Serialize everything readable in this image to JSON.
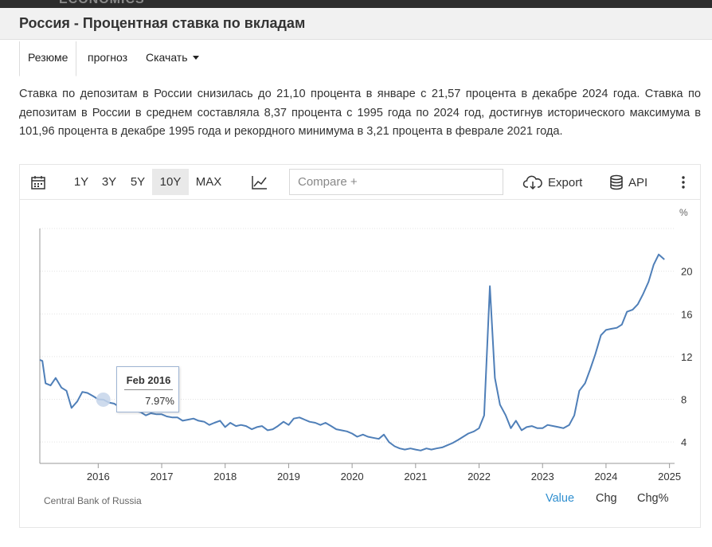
{
  "header": {
    "brand": "ECONOMICS",
    "title": "Россия - Процентная ставка по вкладам"
  },
  "tabs": [
    {
      "label": "Резюме"
    },
    {
      "label": "прогноз"
    },
    {
      "label": "Скачать"
    }
  ],
  "description": "Ставка по депозитам в России снизилась до 21,10 процента в январе с 21,57 процента в декабре 2024 года. Ставка по депозитам в России в среднем составляла 8,37 процента с 1995 года по 2024 год, достигнув исторического максимума в 101,96 процента в декабре 1995 года и рекордного минимума в 3,21 процента в феврале 2021 года.",
  "toolbar": {
    "ranges": [
      "1Y",
      "3Y",
      "5Y",
      "10Y",
      "MAX"
    ],
    "active_range": "10Y",
    "compare_placeholder": "Compare +",
    "export_label": "Export",
    "api_label": "API",
    "icons": [
      "calendar-icon",
      "line-chart-icon",
      "cloud-download-icon",
      "database-icon",
      "more-vertical-icon"
    ]
  },
  "tooltip": {
    "date": "Feb 2016",
    "value": "7.97%"
  },
  "footer": {
    "source": "Central Bank of Russia",
    "value_label": "Value",
    "chg_label": "Chg",
    "chgpct_label": "Chg%"
  },
  "colors": {
    "line": "#4f7fb8",
    "active_footer": "#2e8ecf",
    "tooltip_border": "#9fb5d4"
  },
  "chart_data": {
    "type": "line",
    "title": "",
    "xlabel": "",
    "ylabel": "%",
    "xlim": [
      2015.08,
      2025.08
    ],
    "ylim": [
      2,
      24
    ],
    "yticks": [
      4,
      8,
      12,
      16,
      20
    ],
    "xticks": [
      2016,
      2017,
      2018,
      2019,
      2020,
      2021,
      2022,
      2023,
      2024,
      2025
    ],
    "grid": "horizontal dotted",
    "highlight_point": {
      "x": 2016.08,
      "y": 7.97,
      "label": "Feb 2016"
    },
    "series": [
      {
        "values": [
          [
            2015.08,
            11.7
          ],
          [
            2015.12,
            11.6
          ],
          [
            2015.17,
            9.5
          ],
          [
            2015.25,
            9.3
          ],
          [
            2015.33,
            10.0
          ],
          [
            2015.42,
            9.1
          ],
          [
            2015.5,
            8.8
          ],
          [
            2015.58,
            7.2
          ],
          [
            2015.67,
            7.8
          ],
          [
            2015.75,
            8.7
          ],
          [
            2015.83,
            8.6
          ],
          [
            2015.92,
            8.3
          ],
          [
            2016.0,
            8.0
          ],
          [
            2016.08,
            7.97
          ],
          [
            2016.17,
            7.7
          ],
          [
            2016.25,
            7.6
          ],
          [
            2016.33,
            7.3
          ],
          [
            2016.42,
            7.2
          ],
          [
            2016.5,
            7.0
          ],
          [
            2016.58,
            6.9
          ],
          [
            2016.67,
            6.8
          ],
          [
            2016.75,
            6.5
          ],
          [
            2016.83,
            6.7
          ],
          [
            2016.92,
            6.6
          ],
          [
            2017.0,
            6.6
          ],
          [
            2017.08,
            6.4
          ],
          [
            2017.17,
            6.3
          ],
          [
            2017.25,
            6.3
          ],
          [
            2017.33,
            6.0
          ],
          [
            2017.42,
            6.1
          ],
          [
            2017.5,
            6.2
          ],
          [
            2017.58,
            6.0
          ],
          [
            2017.67,
            5.9
          ],
          [
            2017.75,
            5.6
          ],
          [
            2017.83,
            5.8
          ],
          [
            2017.92,
            6.0
          ],
          [
            2018.0,
            5.4
          ],
          [
            2018.08,
            5.8
          ],
          [
            2018.17,
            5.5
          ],
          [
            2018.25,
            5.6
          ],
          [
            2018.33,
            5.5
          ],
          [
            2018.42,
            5.2
          ],
          [
            2018.5,
            5.4
          ],
          [
            2018.58,
            5.5
          ],
          [
            2018.67,
            5.1
          ],
          [
            2018.75,
            5.2
          ],
          [
            2018.83,
            5.5
          ],
          [
            2018.92,
            5.9
          ],
          [
            2019.0,
            5.6
          ],
          [
            2019.08,
            6.2
          ],
          [
            2019.17,
            6.3
          ],
          [
            2019.25,
            6.1
          ],
          [
            2019.33,
            5.9
          ],
          [
            2019.42,
            5.8
          ],
          [
            2019.5,
            5.6
          ],
          [
            2019.58,
            5.8
          ],
          [
            2019.67,
            5.5
          ],
          [
            2019.75,
            5.2
          ],
          [
            2019.83,
            5.1
          ],
          [
            2019.92,
            5.0
          ],
          [
            2020.0,
            4.8
          ],
          [
            2020.08,
            4.5
          ],
          [
            2020.17,
            4.7
          ],
          [
            2020.25,
            4.5
          ],
          [
            2020.33,
            4.4
          ],
          [
            2020.42,
            4.3
          ],
          [
            2020.5,
            4.7
          ],
          [
            2020.58,
            4.0
          ],
          [
            2020.67,
            3.6
          ],
          [
            2020.75,
            3.4
          ],
          [
            2020.83,
            3.3
          ],
          [
            2020.92,
            3.4
          ],
          [
            2021.0,
            3.3
          ],
          [
            2021.08,
            3.21
          ],
          [
            2021.17,
            3.4
          ],
          [
            2021.25,
            3.3
          ],
          [
            2021.33,
            3.4
          ],
          [
            2021.42,
            3.5
          ],
          [
            2021.5,
            3.7
          ],
          [
            2021.58,
            3.9
          ],
          [
            2021.67,
            4.2
          ],
          [
            2021.75,
            4.5
          ],
          [
            2021.83,
            4.8
          ],
          [
            2021.92,
            5.0
          ],
          [
            2022.0,
            5.3
          ],
          [
            2022.08,
            6.5
          ],
          [
            2022.17,
            18.6
          ],
          [
            2022.25,
            10.0
          ],
          [
            2022.33,
            7.5
          ],
          [
            2022.42,
            6.5
          ],
          [
            2022.5,
            5.3
          ],
          [
            2022.58,
            6.0
          ],
          [
            2022.67,
            5.1
          ],
          [
            2022.75,
            5.4
          ],
          [
            2022.83,
            5.5
          ],
          [
            2022.92,
            5.3
          ],
          [
            2023.0,
            5.3
          ],
          [
            2023.08,
            5.6
          ],
          [
            2023.17,
            5.5
          ],
          [
            2023.25,
            5.4
          ],
          [
            2023.33,
            5.3
          ],
          [
            2023.42,
            5.6
          ],
          [
            2023.5,
            6.5
          ],
          [
            2023.58,
            8.8
          ],
          [
            2023.67,
            9.5
          ],
          [
            2023.75,
            10.8
          ],
          [
            2023.83,
            12.2
          ],
          [
            2023.92,
            14.0
          ],
          [
            2024.0,
            14.5
          ],
          [
            2024.08,
            14.6
          ],
          [
            2024.17,
            14.7
          ],
          [
            2024.25,
            15.0
          ],
          [
            2024.33,
            16.2
          ],
          [
            2024.42,
            16.4
          ],
          [
            2024.5,
            16.9
          ],
          [
            2024.58,
            17.8
          ],
          [
            2024.67,
            19.0
          ],
          [
            2024.75,
            20.6
          ],
          [
            2024.83,
            21.57
          ],
          [
            2024.92,
            21.1
          ]
        ]
      }
    ]
  }
}
